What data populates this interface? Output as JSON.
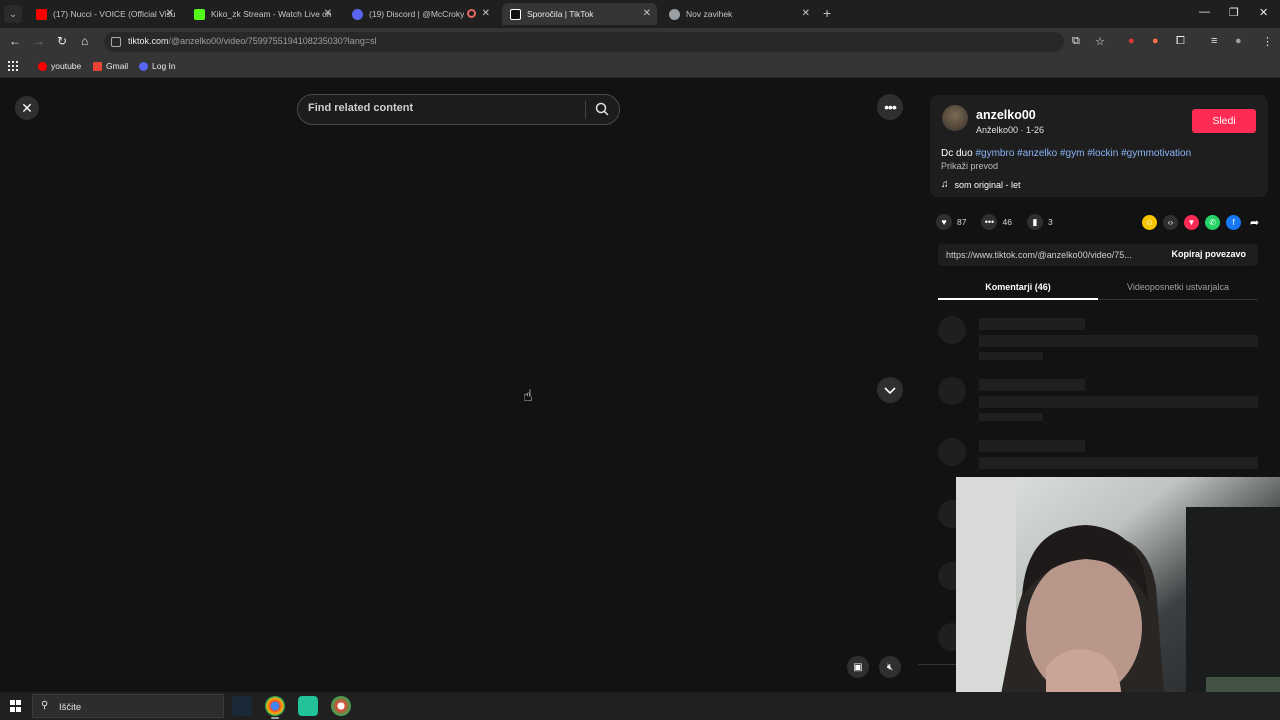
{
  "browser": {
    "tabs": [
      {
        "title": "(17) Nucci - VOICE (Official Visu",
        "favicon_color": "#ff0000",
        "icon": "youtube-icon"
      },
      {
        "title": "Kiko_zk Stream - Watch Live on",
        "favicon_color": "#53fc18",
        "icon": "kick-icon"
      },
      {
        "title": "(19) Discord | @McCroky",
        "favicon_color": "#5865f2",
        "icon": "discord-icon"
      },
      {
        "title": "Sporočila | TikTok",
        "favicon_color": "#ffffff",
        "icon": "tiktok-icon"
      },
      {
        "title": "Nov zavihek",
        "favicon_color": "#9aa0a6",
        "icon": "chrome-icon"
      }
    ],
    "url_domain": "tiktok.com",
    "url_path": "/@anzelko00/video/7599755194108235030?lang=sl",
    "bookmarks": [
      {
        "label": "youtube",
        "color": "#ff0000"
      },
      {
        "label": "Gmail",
        "color": "#ea4335"
      },
      {
        "label": "Log In",
        "color": "#5865f2"
      }
    ]
  },
  "video": {
    "search_placeholder": "Find related content"
  },
  "post": {
    "username": "anzelko00",
    "subtitle": "Anželko00 · 1-26",
    "follow_label": "Sledi",
    "caption_prefix": "Dc duo ",
    "hashtags": [
      "#gymbro",
      "#anzelko",
      "#gym",
      "#lockin",
      "#gymmotivation"
    ],
    "translate_label": "Prikaži prevod",
    "music": "som original - let",
    "likes": "87",
    "comments": "46",
    "saves": "3",
    "link": "https://www.tiktok.com/@anzelko00/video/75...",
    "copy_label": "Kopiraj povezavo",
    "tab_comments": "Komentarji (46)",
    "tab_creator_videos": "Videoposnetki ustvarjalca"
  },
  "taskbar": {
    "search_placeholder": "Iščite"
  },
  "colors": {
    "accent": "#fe2c55",
    "hashtag": "#8ab4f8"
  }
}
